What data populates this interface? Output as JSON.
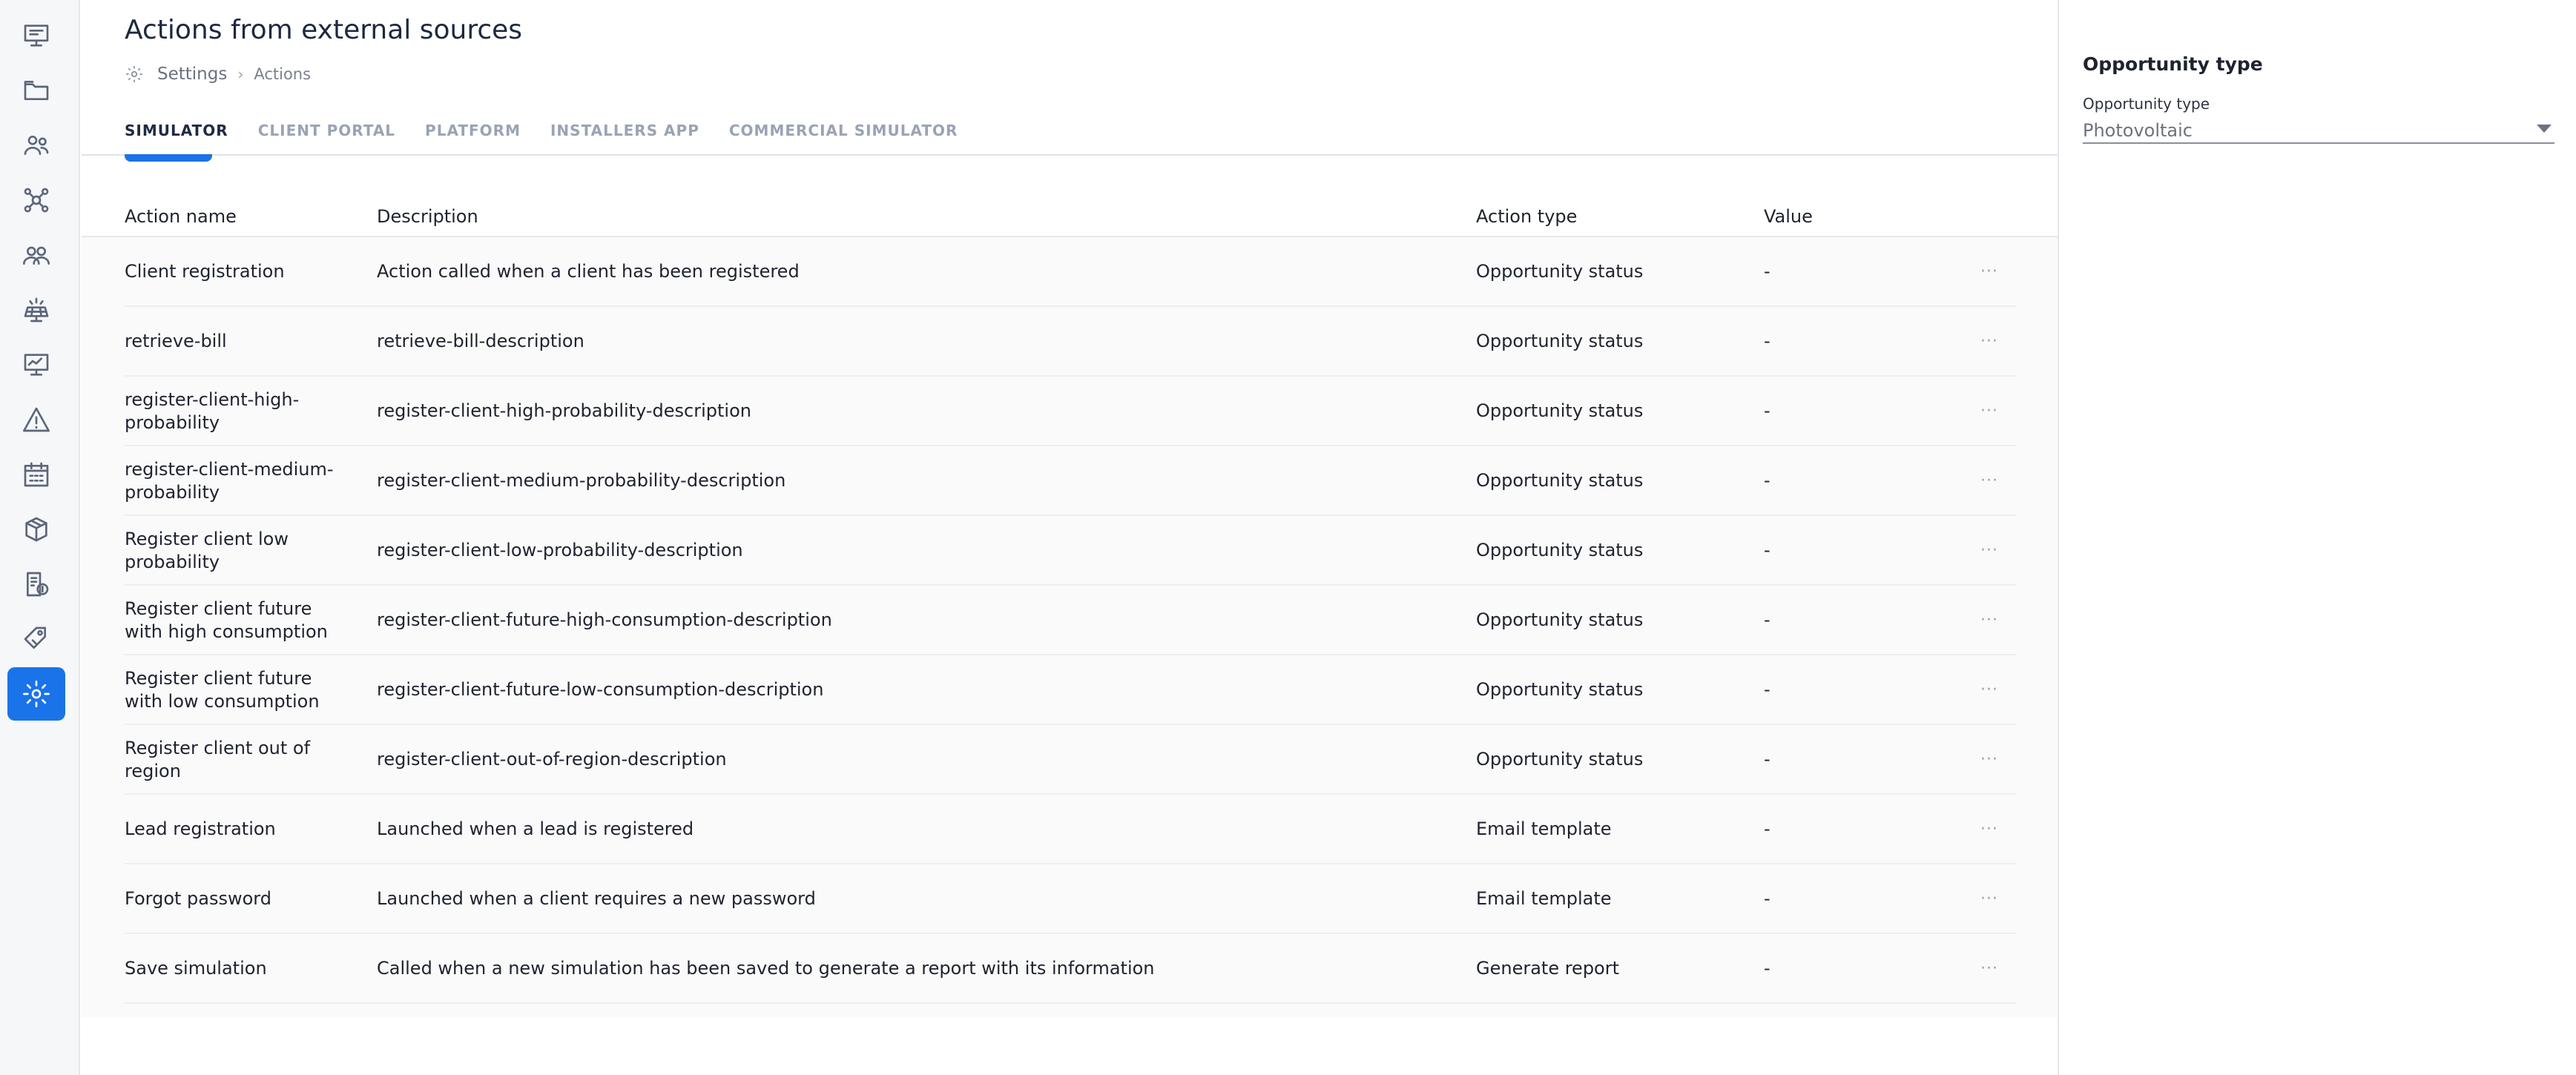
{
  "sidebar": {
    "items": [
      {
        "icon": "dashboard-icon"
      },
      {
        "icon": "folder-icon"
      },
      {
        "icon": "users-icon"
      },
      {
        "icon": "network-icon"
      },
      {
        "icon": "team-icon"
      },
      {
        "icon": "solar-panel-icon"
      },
      {
        "icon": "monitor-icon"
      },
      {
        "icon": "warning-icon"
      },
      {
        "icon": "calendar-icon"
      },
      {
        "icon": "package-icon"
      },
      {
        "icon": "billing-icon"
      },
      {
        "icon": "tag-icon"
      },
      {
        "icon": "settings-icon",
        "active": true
      }
    ]
  },
  "header": {
    "title": "Actions from external sources",
    "breadcrumb": [
      "Settings",
      "Actions"
    ],
    "separator": "›"
  },
  "tabs": [
    {
      "label": "SIMULATOR",
      "active": true
    },
    {
      "label": "CLIENT PORTAL"
    },
    {
      "label": "PLATFORM"
    },
    {
      "label": "INSTALLERS APP"
    },
    {
      "label": "COMMERCIAL SIMULATOR"
    }
  ],
  "table": {
    "columns": [
      "Action name",
      "Description",
      "Action type",
      "Value"
    ],
    "rows": [
      {
        "name": "Client registration",
        "description": "Action called when a client has been registered",
        "type": "Opportunity status",
        "value": "-"
      },
      {
        "name": "retrieve-bill",
        "description": "retrieve-bill-description",
        "type": "Opportunity status",
        "value": "-"
      },
      {
        "name": "register-client-high-probability",
        "description": "register-client-high-probability-description",
        "type": "Opportunity status",
        "value": "-"
      },
      {
        "name": "register-client-medium-probability",
        "description": "register-client-medium-probability-description",
        "type": "Opportunity status",
        "value": "-"
      },
      {
        "name": "Register client low probability",
        "description": "register-client-low-probability-description",
        "type": "Opportunity status",
        "value": "-"
      },
      {
        "name": "Register client future with high consumption",
        "description": "register-client-future-high-consumption-description",
        "type": "Opportunity status",
        "value": "-"
      },
      {
        "name": "Register client future with low consumption",
        "description": "register-client-future-low-consumption-description",
        "type": "Opportunity status",
        "value": "-"
      },
      {
        "name": "Register client out of region",
        "description": "register-client-out-of-region-description",
        "type": "Opportunity status",
        "value": "-"
      },
      {
        "name": "Lead registration",
        "description": "Launched when a lead is registered",
        "type": "Email template",
        "value": "-"
      },
      {
        "name": "Forgot password",
        "description": "Launched when a client requires a new password",
        "type": "Email template",
        "value": "-"
      },
      {
        "name": "Save simulation",
        "description": "Called when a new simulation has been saved to generate a report with its information",
        "type": "Generate report",
        "value": "-"
      }
    ],
    "row_menu_glyph": "···"
  },
  "panel": {
    "title": "Opportunity type",
    "field_label": "Opportunity type",
    "selected_value": "Photovoltaic"
  },
  "colors": {
    "accent": "#1a73e8",
    "sidebar_bg": "#f6f7f9",
    "title": "#1d2840"
  }
}
